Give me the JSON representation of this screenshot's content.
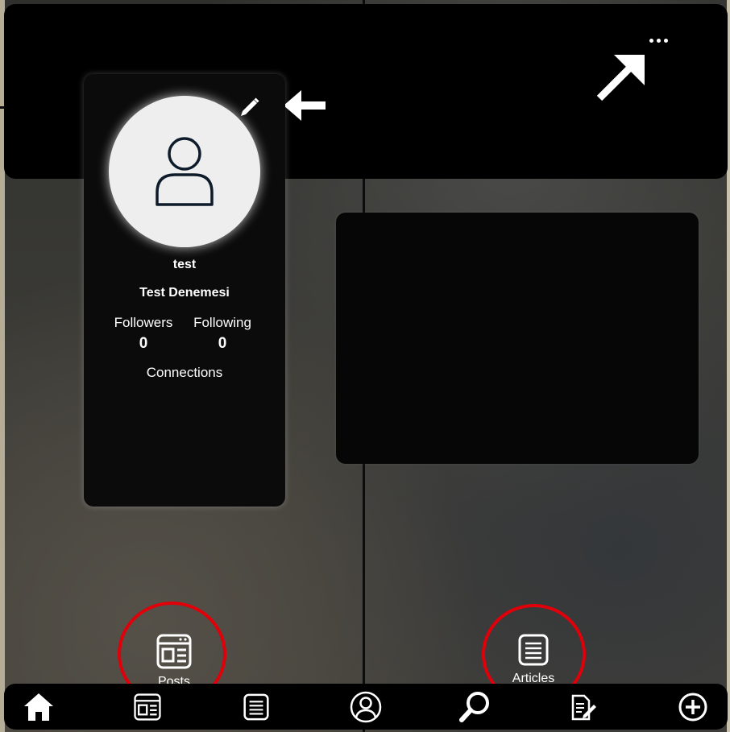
{
  "header": {
    "more_icon": "more-horizontal-icon",
    "annotation_arrows": [
      "arrow-up-right-icon",
      "arrow-left-icon"
    ]
  },
  "profile": {
    "avatar_icon": "user-icon",
    "edit_icon": "pencil-icon",
    "username": "test",
    "full_name": "Test Denemesi",
    "followers_label": "Followers",
    "followers_count": "0",
    "following_label": "Following",
    "following_count": "0",
    "connections_label": "Connections"
  },
  "tabs": {
    "posts": {
      "label": "Posts",
      "icon": "posts-icon"
    },
    "articles": {
      "label": "Articles",
      "icon": "articles-icon"
    }
  },
  "bottom_nav": [
    {
      "icon": "home-icon"
    },
    {
      "icon": "feed-icon"
    },
    {
      "icon": "document-list-icon"
    },
    {
      "icon": "profile-icon"
    },
    {
      "icon": "search-icon"
    },
    {
      "icon": "write-icon"
    },
    {
      "icon": "add-icon"
    }
  ],
  "colors": {
    "annotation_red": "#e0000a",
    "panel": "#0b0b0b",
    "avatar_bg": "#eeeeee",
    "avatar_stroke": "#0d1b2a"
  }
}
